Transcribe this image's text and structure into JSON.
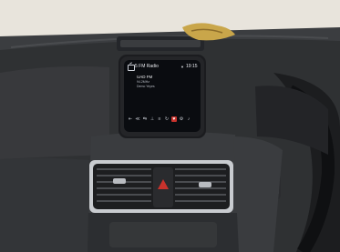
{
  "infotainment": {
    "source_label": "FM Radio",
    "source_number": "5",
    "clock": "19:15",
    "station_name": "UAD FM",
    "station_line_1": "94.2MHz",
    "station_line_2": "Demo Yeyes"
  },
  "controls": [
    {
      "icon": "prev-icon",
      "glyph": "⇤"
    },
    {
      "icon": "rewind-icon",
      "glyph": "≪"
    },
    {
      "icon": "seek-icon",
      "glyph": "⇆"
    },
    {
      "icon": "tune-icon",
      "glyph": "⊥"
    },
    {
      "icon": "list-icon",
      "glyph": "≡"
    },
    {
      "icon": "scan-icon",
      "glyph": "↻"
    },
    {
      "icon": "favorite-icon",
      "glyph": "♥"
    },
    {
      "icon": "settings-icon",
      "glyph": "⚙"
    },
    {
      "icon": "sound-icon",
      "glyph": "♪"
    }
  ],
  "colors": {
    "dashboard": "#2f3133",
    "screen": "#0a0c10",
    "hazard": "#c8322c",
    "trim": "#c9ccd0"
  }
}
